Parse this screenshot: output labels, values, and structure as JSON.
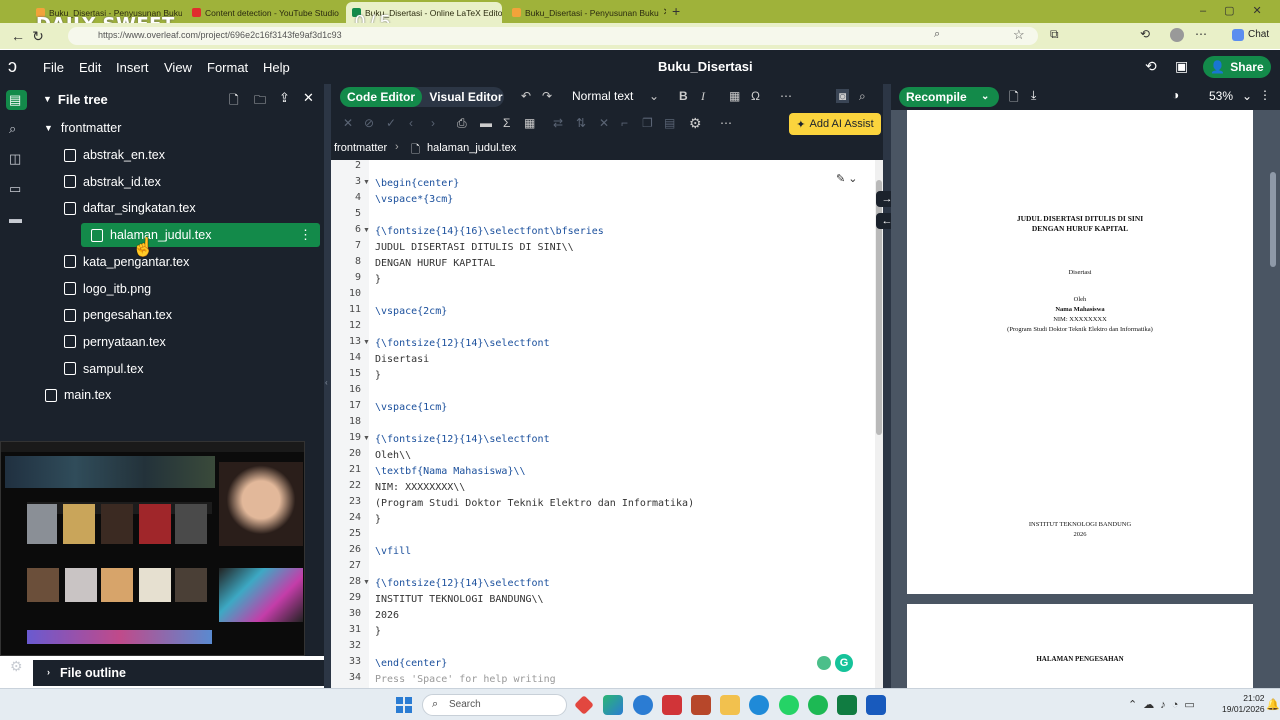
{
  "browser": {
    "tabs": [
      {
        "label": "Buku_Disertasi - Penyusunan Buku",
        "color": "#f2a33a"
      },
      {
        "label": "Content detection - YouTube Studio",
        "color": "#e12d2d"
      },
      {
        "label": "Buku_Disertasi - Online LaTeX Editor",
        "color": "#138a4a"
      },
      {
        "label": "Buku_Disertasi - Penyusunan Buku",
        "color": "#f2a33a"
      }
    ],
    "url": "https://www.overleaf.com/project/696e2c16f3143fe9af3d1c93",
    "watermark": "DAILY SWEET",
    "counter": "0 / 5",
    "chat_label": "Chat"
  },
  "header": {
    "menu": [
      "File",
      "Edit",
      "Insert",
      "View",
      "Format",
      "Help"
    ],
    "project_title": "Buku_Disertasi",
    "share_label": "Share"
  },
  "file_tree": {
    "title": "File tree",
    "folder": "frontmatter",
    "files": [
      "abstrak_en.tex",
      "abstrak_id.tex",
      "daftar_singkatan.tex",
      "halaman_judul.tex",
      "kata_pengantar.tex",
      "logo_itb.png",
      "pengesahan.tex",
      "pernyataan.tex",
      "sampul.tex"
    ],
    "selected": "halaman_judul.tex",
    "root_file": "main.tex",
    "outline_label": "File outline"
  },
  "editor": {
    "code_editor_label": "Code Editor",
    "visual_editor_label": "Visual Editor",
    "text_style": "Normal text",
    "ai_assist_label": "Add AI Assist",
    "breadcrumb": [
      "frontmatter",
      "halaman_judul.tex"
    ],
    "lines": [
      {
        "n": "2",
        "t": ""
      },
      {
        "n": "3",
        "t": "\\begin{center}"
      },
      {
        "n": "4",
        "t": "\\vspace*{3cm}"
      },
      {
        "n": "5",
        "t": ""
      },
      {
        "n": "6",
        "t": "{\\fontsize{14}{16}\\selectfont\\bfseries"
      },
      {
        "n": "7",
        "t": "JUDUL DISERTASI DITULIS DI SINI\\\\"
      },
      {
        "n": "8",
        "t": "DENGAN HURUF KAPITAL"
      },
      {
        "n": "9",
        "t": "}"
      },
      {
        "n": "10",
        "t": ""
      },
      {
        "n": "11",
        "t": "\\vspace{2cm}"
      },
      {
        "n": "12",
        "t": ""
      },
      {
        "n": "13",
        "t": "{\\fontsize{12}{14}\\selectfont"
      },
      {
        "n": "14",
        "t": "Disertasi"
      },
      {
        "n": "15",
        "t": "}"
      },
      {
        "n": "16",
        "t": ""
      },
      {
        "n": "17",
        "t": "\\vspace{1cm}"
      },
      {
        "n": "18",
        "t": ""
      },
      {
        "n": "19",
        "t": "{\\fontsize{12}{14}\\selectfont"
      },
      {
        "n": "20",
        "t": "Oleh\\\\"
      },
      {
        "n": "21",
        "t": "\\textbf{Nama Mahasiswa}\\\\"
      },
      {
        "n": "22",
        "t": "NIM: XXXXXXXX\\\\"
      },
      {
        "n": "23",
        "t": "(Program Studi Doktor Teknik Elektro dan Informatika)"
      },
      {
        "n": "24",
        "t": "}"
      },
      {
        "n": "25",
        "t": ""
      },
      {
        "n": "26",
        "t": "\\vfill"
      },
      {
        "n": "27",
        "t": ""
      },
      {
        "n": "28",
        "t": "{\\fontsize{12}{14}\\selectfont"
      },
      {
        "n": "29",
        "t": "INSTITUT TEKNOLOGI BANDUNG\\\\"
      },
      {
        "n": "30",
        "t": "2026"
      },
      {
        "n": "31",
        "t": "}"
      },
      {
        "n": "32",
        "t": ""
      },
      {
        "n": "33",
        "t": "\\end{center}"
      },
      {
        "n": "34",
        "t": "Press 'Space' for help writing"
      }
    ]
  },
  "pdf": {
    "recompile_label": "Recompile",
    "zoom": "53%",
    "page1": {
      "title_line1": "JUDUL DISERTASI DITULIS DI SINI",
      "title_line2": "DENGAN HURUF KAPITAL",
      "type": "Disertasi",
      "by": "Oleh",
      "name": "Nama Mahasiswa",
      "nim": "NIM: XXXXXXXX",
      "program": "(Program Studi Doktor Teknik Elektro dan Informatika)",
      "institute": "INSTITUT TEKNOLOGI BANDUNG",
      "year": "2026"
    },
    "page2": {
      "heading": "HALAMAN PENGESAHAN"
    }
  },
  "taskbar": {
    "search_placeholder": "Search",
    "time": "21:02",
    "date": "19/01/2026"
  }
}
